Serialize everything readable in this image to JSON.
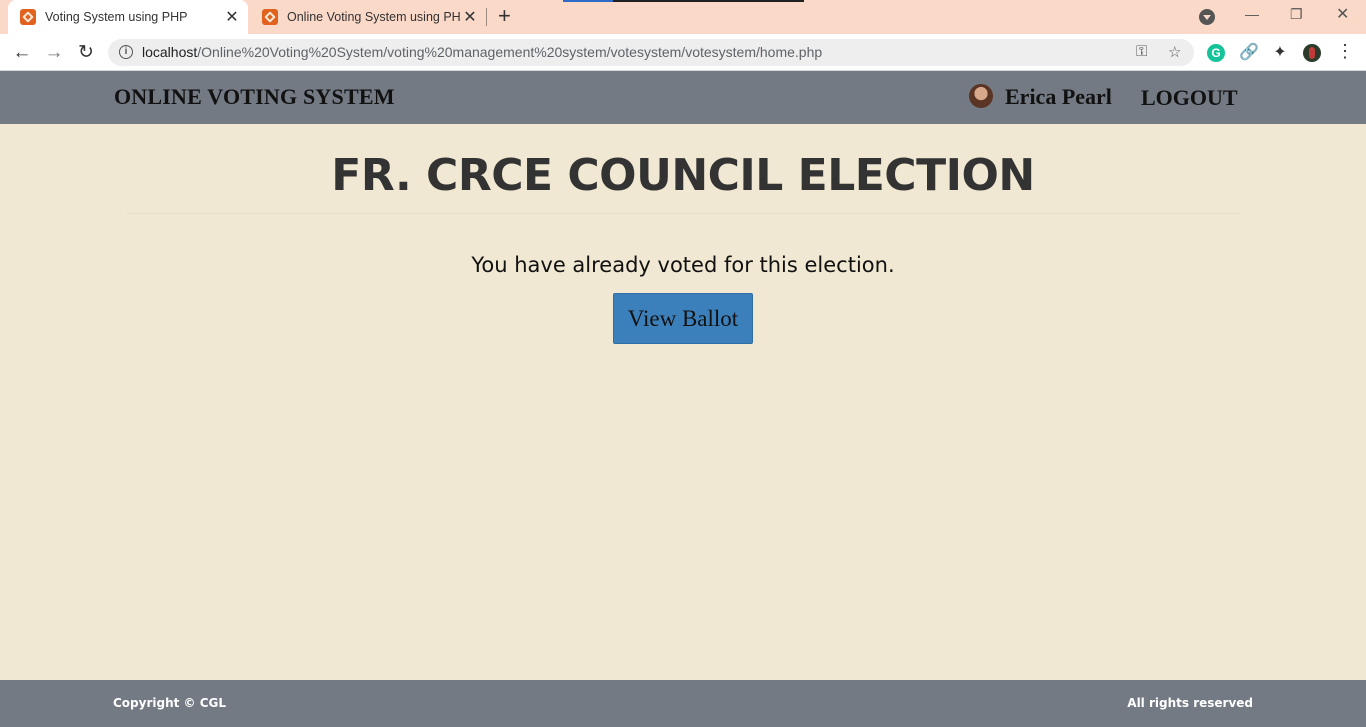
{
  "browser": {
    "tabs": [
      {
        "title": "Voting System using PHP",
        "close": "✕"
      },
      {
        "title": "Online Voting System using PHP",
        "close": "✕"
      }
    ],
    "new_tab": "+",
    "window": {
      "minimize": "—",
      "restore": "❐",
      "close": "✕"
    },
    "nav": {
      "back": "←",
      "forward": "→",
      "reload": "↻"
    },
    "url_host": "localhost",
    "url_path": "/Online%20Voting%20System/voting%20management%20system/votesystem/votesystem/home.php",
    "omnibox_icons": {
      "key": "⚿",
      "bookmark": "☆"
    },
    "extensions": {
      "grammarly": "G",
      "link": "🔗",
      "puzzle": "✦"
    },
    "menu": "⋮"
  },
  "navbar": {
    "brand": "ONLINE VOTING SYSTEM",
    "user_name": "Erica Pearl",
    "logout": "LOGOUT"
  },
  "main": {
    "title": "FR. CRCE COUNCIL ELECTION",
    "message": "You have already voted for this election.",
    "view_ballot": "View Ballot"
  },
  "footer": {
    "copyright": "Copyright © CGL",
    "rights": "All rights reserved"
  },
  "colors": {
    "page_bg": "#f0e8d2",
    "navbar_bg": "#737a83",
    "button_bg": "#3c80bb",
    "tabbar_bg": "#fbd9c8"
  }
}
